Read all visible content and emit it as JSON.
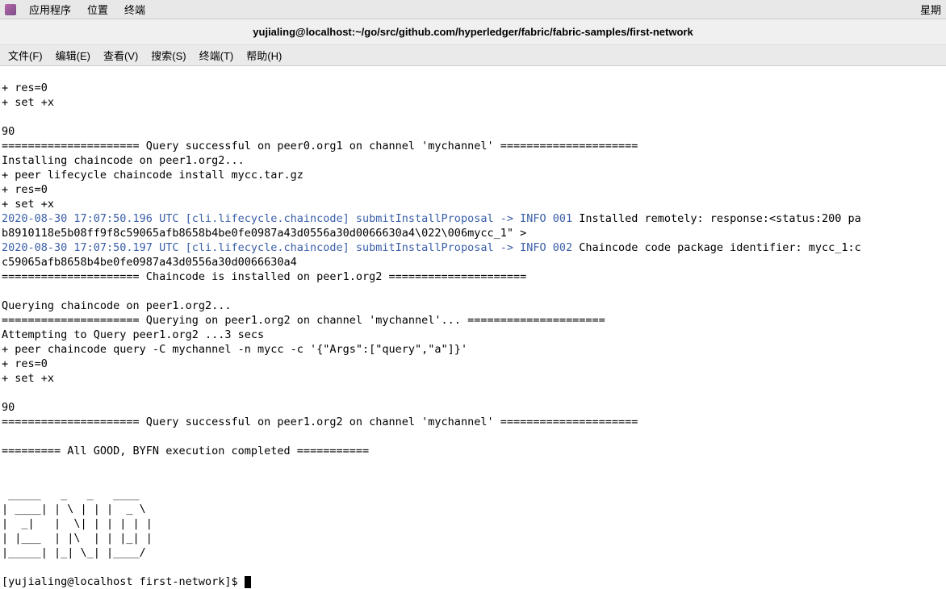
{
  "panel": {
    "apps": "应用程序",
    "places": "位置",
    "terminal": "终端",
    "clock": "星期"
  },
  "window": {
    "title": "yujialing@localhost:~/go/src/github.com/hyperledger/fabric/fabric-samples/first-network"
  },
  "menubar": {
    "file": "文件(F)",
    "edit": "编辑(E)",
    "view": "查看(V)",
    "search": "搜索(S)",
    "terminal": "终端(T)",
    "help": "帮助(H)"
  },
  "term": {
    "l1": "+ res=0",
    "l2": "+ set +x",
    "l3": "",
    "l4": "90",
    "l5": "===================== Query successful on peer0.org1 on channel 'mychannel' =====================",
    "l6": "Installing chaincode on peer1.org2...",
    "l7": "+ peer lifecycle chaincode install mycc.tar.gz",
    "l8": "+ res=0",
    "l9": "+ set +x",
    "l10a": "2020-08-30 17:07:50.196 UTC [cli.lifecycle.chaincode] submitInstallProposal -> INFO 001",
    "l10b": " Installed remotely: response:<status:200 pa",
    "l11": "b8910118e5b08ff9f8c59065afb8658b4be0fe0987a43d0556a30d0066630a4\\022\\006mycc_1\" >",
    "l12a": "2020-08-30 17:07:50.197 UTC [cli.lifecycle.chaincode] submitInstallProposal -> INFO 002",
    "l12b": " Chaincode code package identifier: mycc_1:c",
    "l13": "c59065afb8658b4be0fe0987a43d0556a30d0066630a4",
    "l14": "===================== Chaincode is installed on peer1.org2 =====================",
    "l15": "",
    "l16": "Querying chaincode on peer1.org2...",
    "l17": "===================== Querying on peer1.org2 on channel 'mychannel'... =====================",
    "l18": "Attempting to Query peer1.org2 ...3 secs",
    "l19": "+ peer chaincode query -C mychannel -n mycc -c '{\"Args\":[\"query\",\"a\"]}'",
    "l20": "+ res=0",
    "l21": "+ set +x",
    "l22": "",
    "l23": "90",
    "l24": "===================== Query successful on peer1.org2 on channel 'mychannel' =====================",
    "l25": "",
    "l26": "========= All GOOD, BYFN execution completed =========== ",
    "l27": "",
    "l28": "",
    "end1": " _____   _   _   ____   ",
    "end2": "| ____| | \\ | | |  _ \\  ",
    "end3": "|  _|   |  \\| | | | | | ",
    "end4": "| |___  | |\\  | | |_| | ",
    "end5": "|_____| |_| \\_| |____/  ",
    "l29": "",
    "prompt": "[yujialing@localhost first-network]$ "
  }
}
